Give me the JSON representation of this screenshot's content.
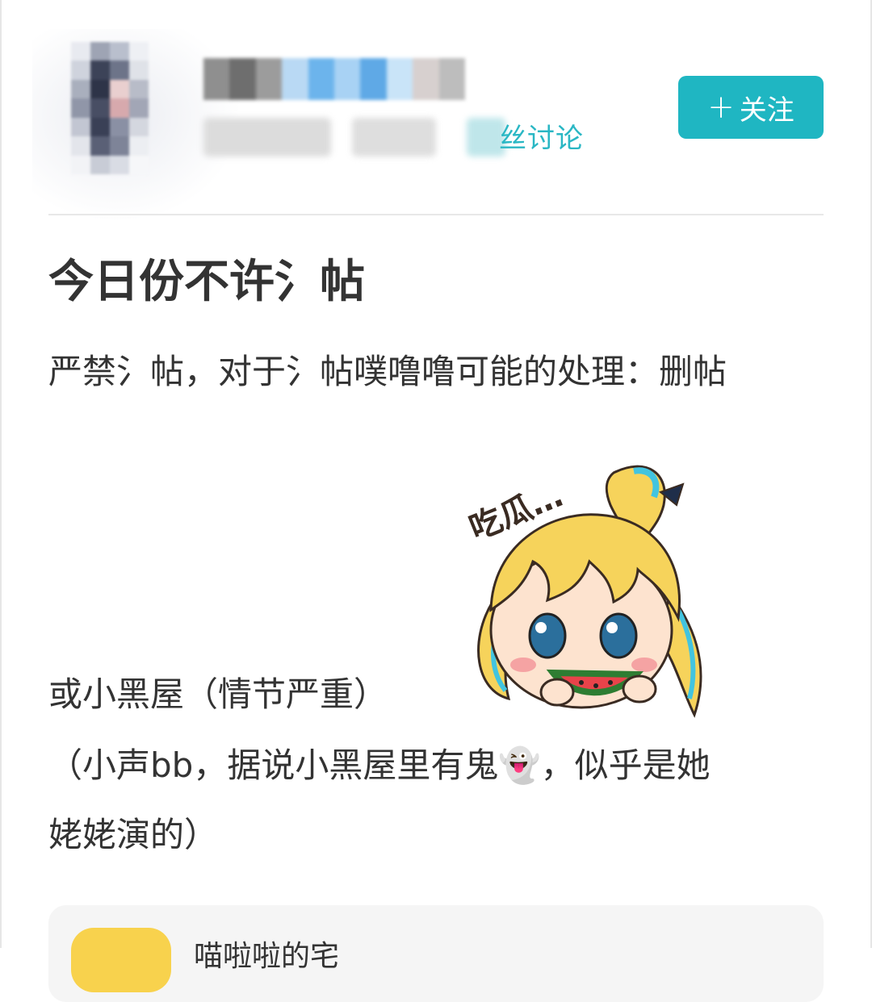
{
  "header": {
    "fans_label": "丝讨论",
    "follow_button": {
      "plus": "+",
      "label": "关注"
    }
  },
  "post": {
    "title": "今日份不许氵帖",
    "paragraphs": [
      "严禁氵帖，对于氵帖噗噜噜可能的处理：删帖",
      "或小黑屋（情节严重）",
      "（小声bb，据说小黑屋里有鬼👻，似乎是她",
      "姥姥演的）"
    ],
    "sticker": {
      "text": "吃瓜…",
      "icon": "watermelon-girl-sticker"
    }
  },
  "card": {
    "title": "喵啦啦的宅"
  },
  "colors": {
    "accent": "#1fb6c2",
    "fans_text": "#2ab7c4",
    "badge": "#f8d24d"
  }
}
